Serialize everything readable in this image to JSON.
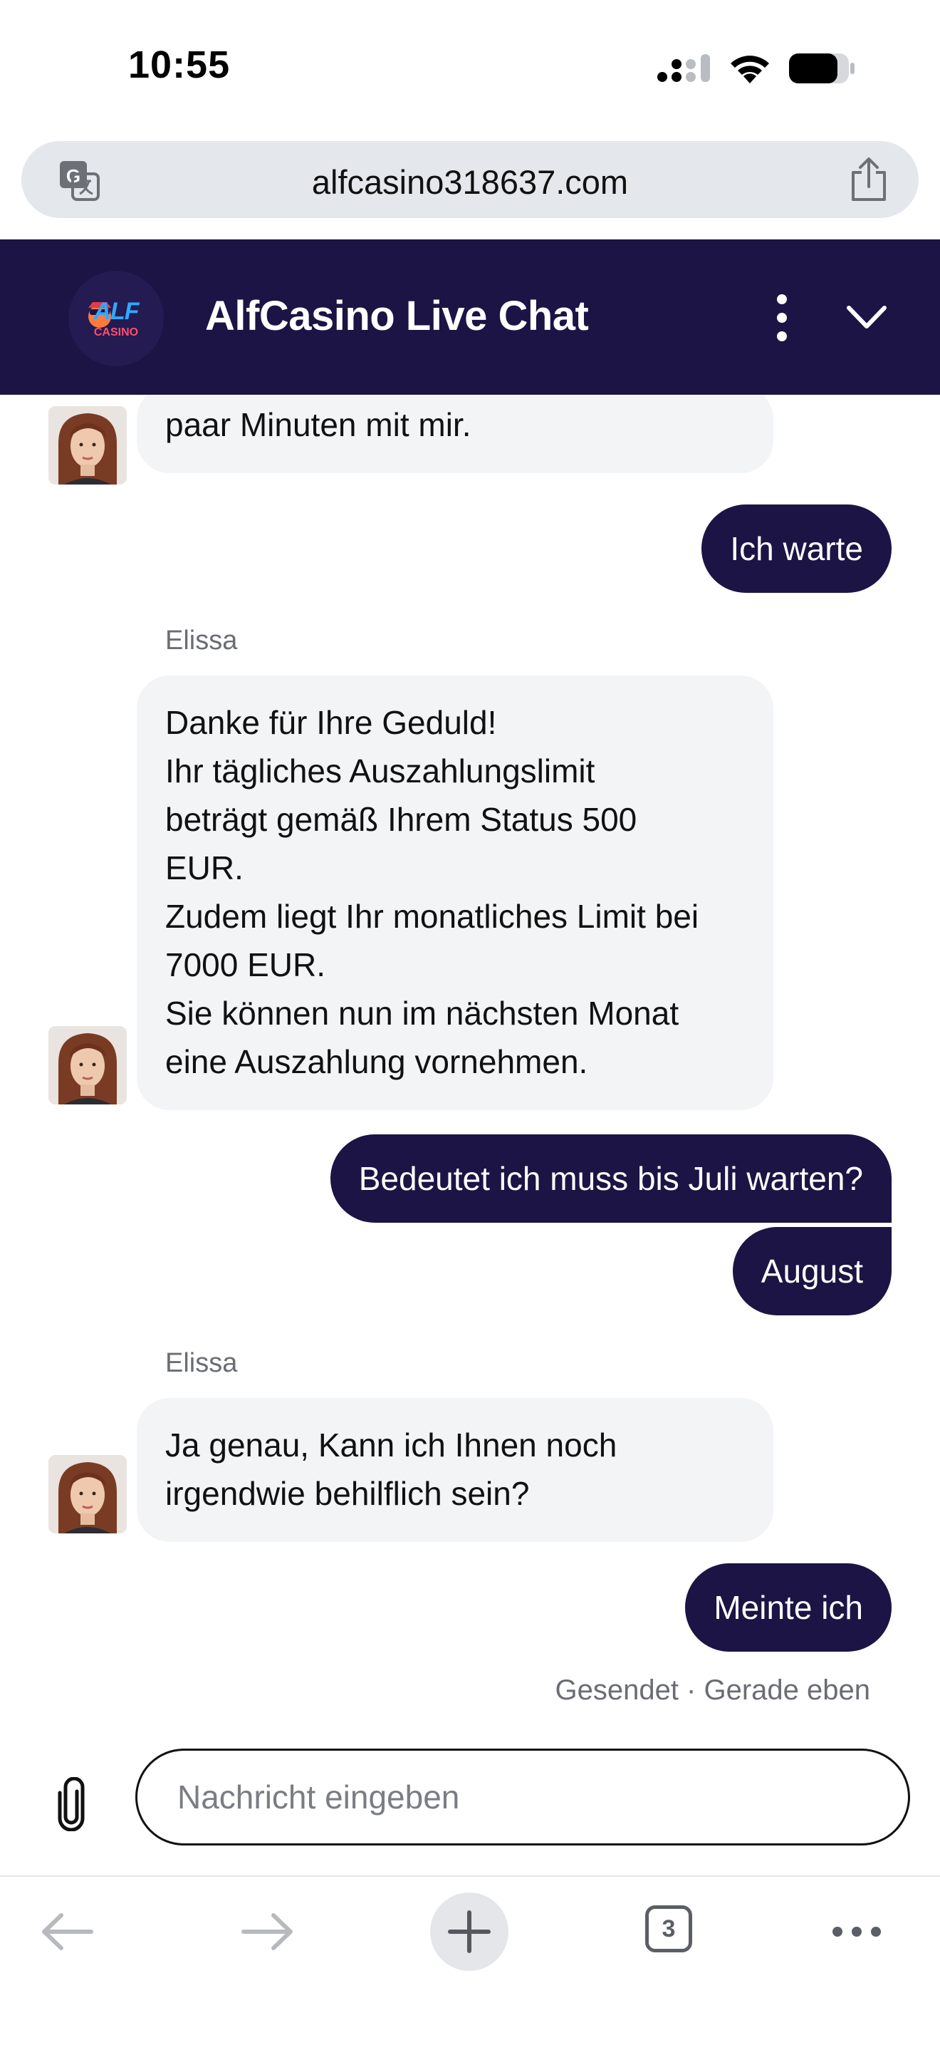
{
  "status_bar": {
    "time": "10:55"
  },
  "browser": {
    "url": "alfcasino318637.com",
    "tab_count": "3"
  },
  "chat": {
    "logo_text": "ALF",
    "logo_subtext": "CASINO",
    "title": "AlfCasino Live Chat",
    "input_placeholder": "Nachricht eingeben",
    "sent_status": "Gesendet · Gerade eben",
    "messages": [
      {
        "from": "agent",
        "lines": [
          "paar Minuten mit mir."
        ]
      },
      {
        "from": "user",
        "text": "Ich warte"
      },
      {
        "from": "agent",
        "sender": "Elissa",
        "lines": [
          "Danke für Ihre Geduld!",
          "Ihr tägliches Auszahlungslimit",
          "beträgt gemäß Ihrem Status 500",
          "EUR.",
          "Zudem liegt Ihr monatliches Limit bei",
          "7000 EUR.",
          "Sie können nun im nächsten Monat",
          "eine Auszahlung vornehmen."
        ]
      },
      {
        "from": "user",
        "text": "Bedeutet ich muss bis Juli warten?"
      },
      {
        "from": "user",
        "text": "August"
      },
      {
        "from": "agent",
        "sender": "Elissa",
        "lines": [
          "Ja genau, Kann ich Ihnen noch",
          "irgendwie behilflich sein?"
        ]
      },
      {
        "from": "user",
        "text": "Meinte ich"
      }
    ]
  },
  "colors": {
    "brand_dark": "#1b1444",
    "bubble_incoming": "#f3f4f6",
    "muted_text": "#6a6d73"
  },
  "icons": {
    "translate": "translate-icon",
    "share": "share-icon",
    "more": "more-vertical-icon",
    "collapse": "chevron-down-icon",
    "attach": "paperclip-icon",
    "back": "arrow-left-icon",
    "forward": "arrow-right-icon",
    "new_tab": "plus-icon",
    "tabs": "tabs-icon",
    "menu": "more-horizontal-icon"
  }
}
